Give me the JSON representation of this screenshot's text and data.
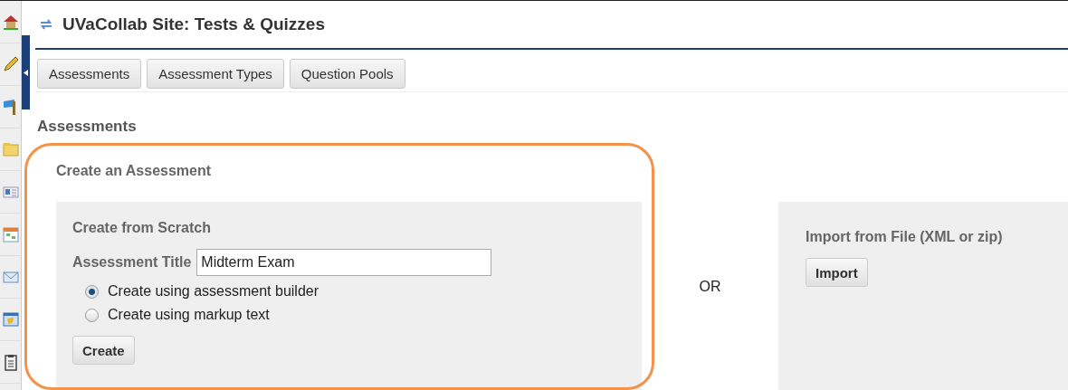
{
  "sidebar": {
    "items": [
      {
        "kind": "home"
      },
      {
        "kind": "pencil"
      },
      {
        "kind": "flag"
      },
      {
        "kind": "folder"
      },
      {
        "kind": "card"
      },
      {
        "kind": "calendar"
      },
      {
        "kind": "mail"
      },
      {
        "kind": "announcement"
      },
      {
        "kind": "clipboard"
      }
    ]
  },
  "title": "UVaCollab Site: Tests & Quizzes",
  "tabs": [
    {
      "label": "Assessments"
    },
    {
      "label": "Assessment Types"
    },
    {
      "label": "Question Pools"
    }
  ],
  "heading": "Assessments",
  "create": {
    "title": "Create an Assessment",
    "scratch": {
      "heading": "Create from Scratch",
      "field_label": "Assessment Title",
      "field_value": "Midterm Exam",
      "options": [
        {
          "label": "Create using assessment builder",
          "selected": true
        },
        {
          "label": "Create using markup text",
          "selected": false
        }
      ],
      "button": "Create"
    },
    "or": "OR",
    "import": {
      "heading": "Import from File (XML or zip)",
      "button": "Import"
    }
  }
}
